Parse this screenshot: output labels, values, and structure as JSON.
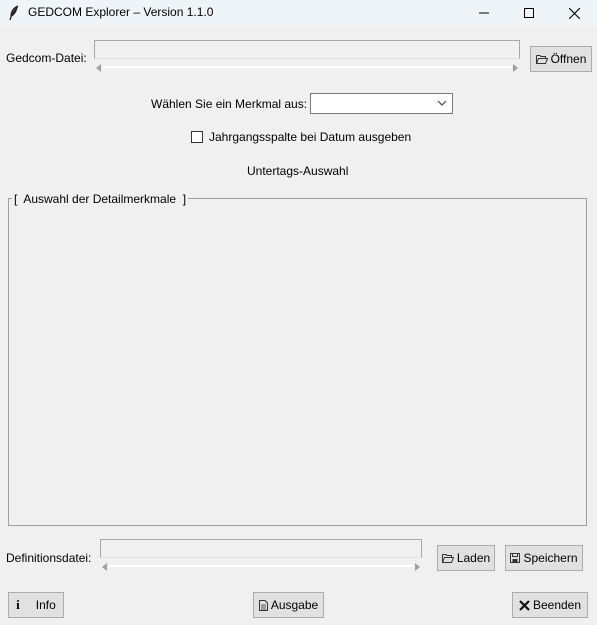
{
  "window": {
    "title": "GEDCOM Explorer – Version 1.1.0",
    "app_icon": "feather-icon",
    "controls": [
      "minimize-icon",
      "maximize-icon",
      "close-icon"
    ]
  },
  "gedcom": {
    "label": "Gedcom-Datei:",
    "value": "",
    "open_button": "Öffnen",
    "open_icon": "folder-open-icon"
  },
  "feature": {
    "label": "Wählen Sie ein Merkmal aus:",
    "selected": ""
  },
  "year_column": {
    "label": "Jahrgangsspalte bei Datum ausgeben",
    "checked": false
  },
  "subtag": {
    "label": "Untertags-Auswahl"
  },
  "detail_group": {
    "title": "[  Auswahl der Detailmerkmale  ]"
  },
  "definition": {
    "label": "Definitionsdatei:",
    "value": "",
    "load_button": "Laden",
    "load_icon": "folder-open-icon",
    "save_button": "Speichern",
    "save_icon": "floppy-disk-icon"
  },
  "footer": {
    "info_button": "Info",
    "info_icon": "info-icon",
    "output_button": "Ausgabe",
    "output_icon": "document-icon",
    "exit_button": "Beenden",
    "exit_icon": "x-icon"
  },
  "colors": {
    "window_bg": "#f0f0f0",
    "titlebar_bg": "#eff4f9",
    "button_bg": "#e1e1e1",
    "button_border": "#adadad"
  }
}
